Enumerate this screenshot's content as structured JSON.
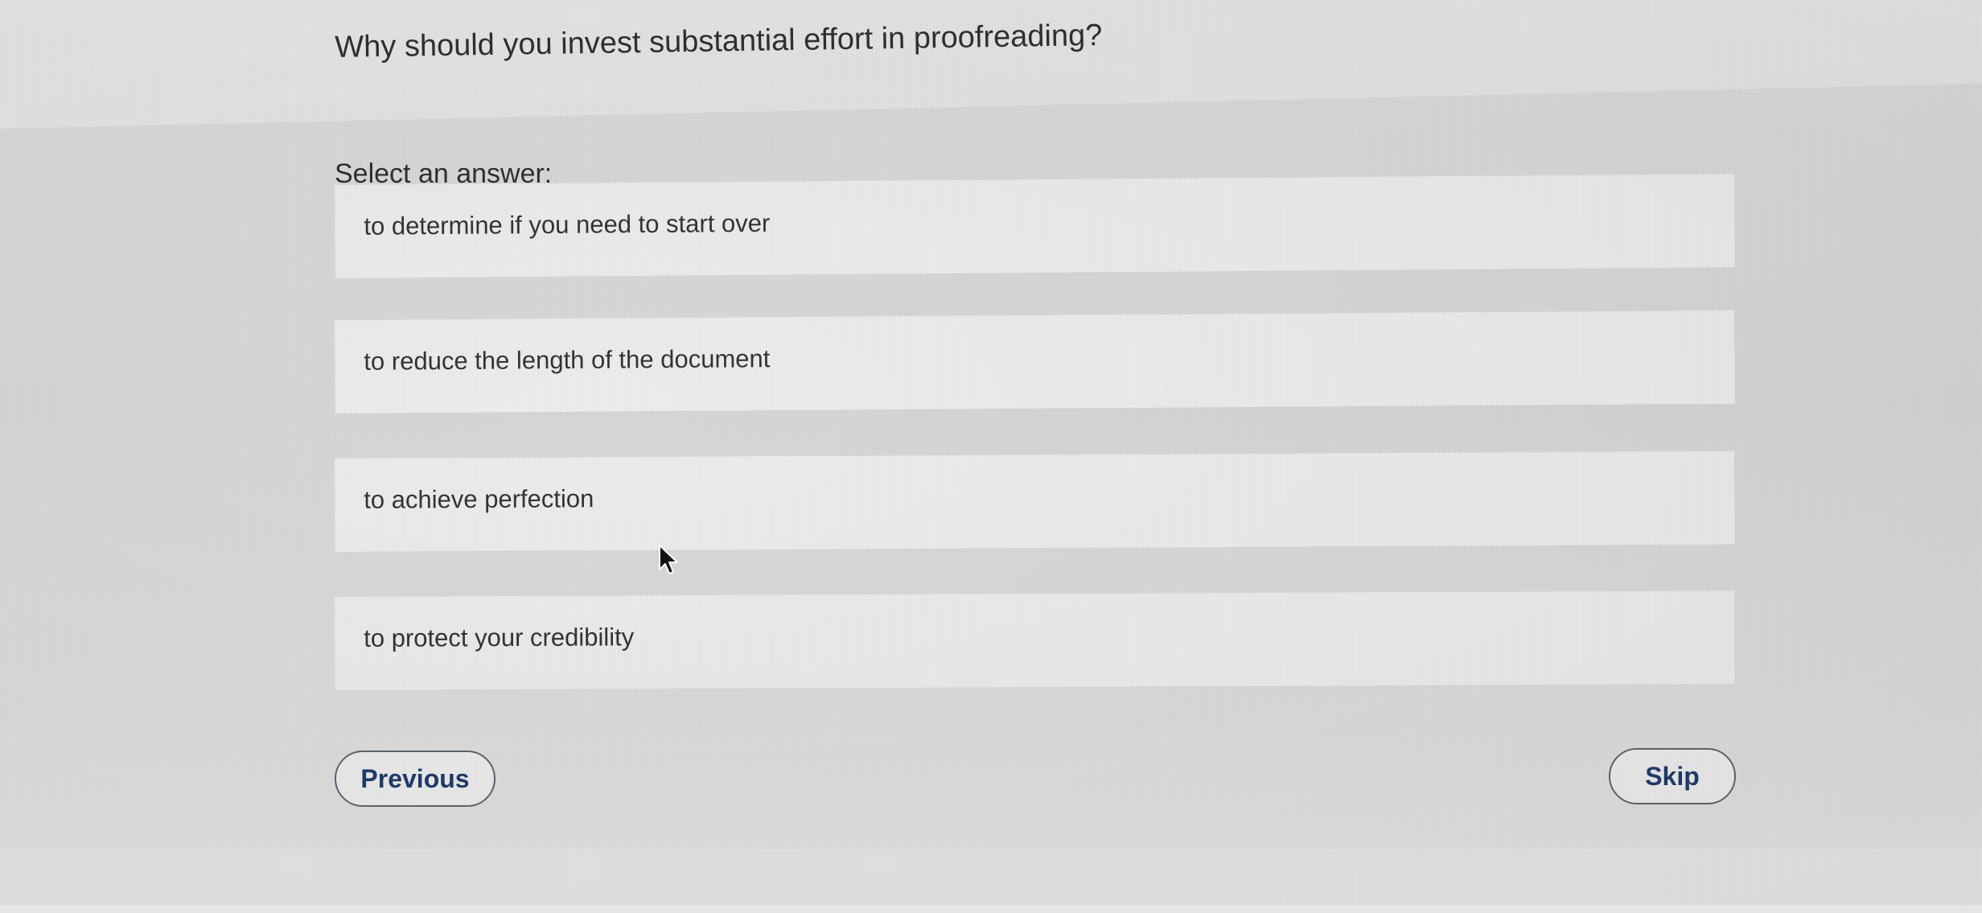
{
  "question": {
    "text": "Why should you invest substantial effort in proofreading?"
  },
  "prompt": {
    "text": "Select an answer:"
  },
  "answers": [
    {
      "label": "to determine if you need to start over"
    },
    {
      "label": "to reduce the length of the document"
    },
    {
      "label": "to achieve perfection"
    },
    {
      "label": "to protect your credibility"
    }
  ],
  "navigation": {
    "previous_label": "Previous",
    "skip_label": "Skip"
  },
  "colors": {
    "button_text": "#1f3a6b",
    "button_border": "#5c6470",
    "answer_background": "#ececec"
  },
  "icons": {
    "cursor": "mouse-pointer-icon"
  }
}
